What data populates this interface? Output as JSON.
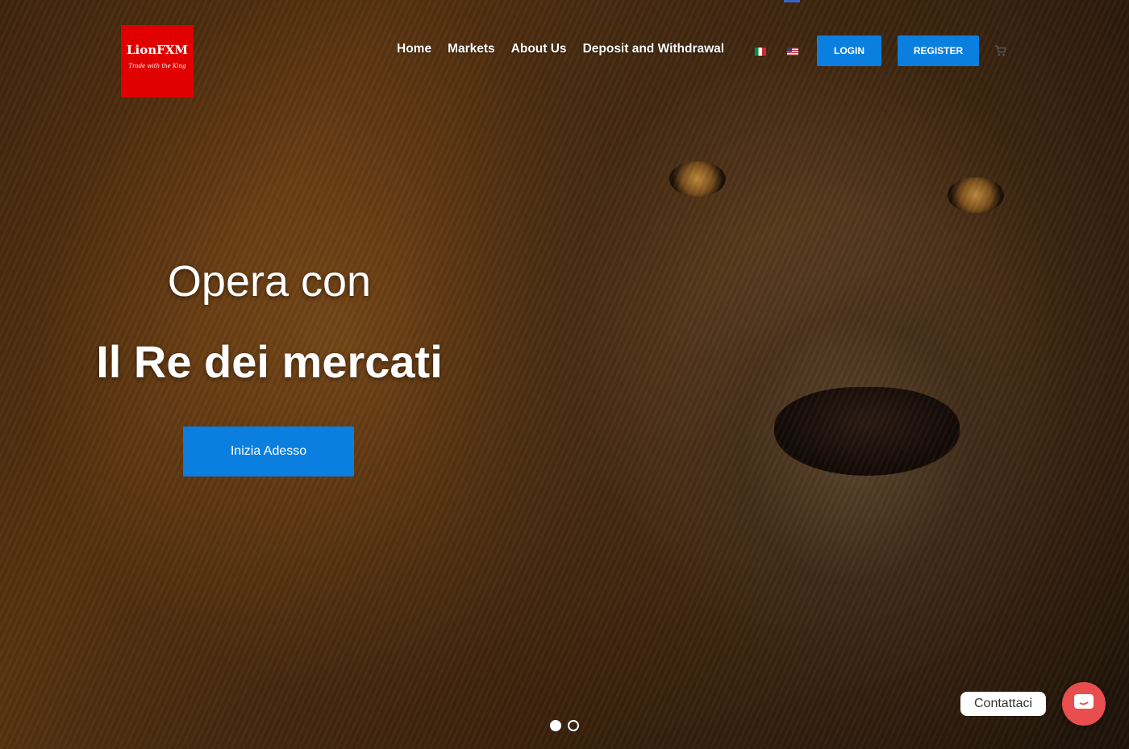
{
  "logo": {
    "name": "LionFXM",
    "tagline": "Trade with the King"
  },
  "nav": {
    "items": [
      "Home",
      "Markets",
      "About Us",
      "Deposit and Withdrawal"
    ],
    "flags": [
      "italy-flag-icon",
      "us-flag-icon"
    ],
    "login_label": "LOGIN",
    "register_label": "REGISTER",
    "cart_icon": "cart-icon"
  },
  "hero": {
    "line1": "Opera con",
    "line2": "Il Re dei mercati",
    "cta_label": "Inizia Adesso",
    "slides_total": 2,
    "active_slide": 1
  },
  "contact": {
    "label": "Contattaci"
  },
  "colors": {
    "brand_red": "#e00000",
    "accent_blue": "#0a7fe0",
    "contact_red": "#e94e4e"
  }
}
